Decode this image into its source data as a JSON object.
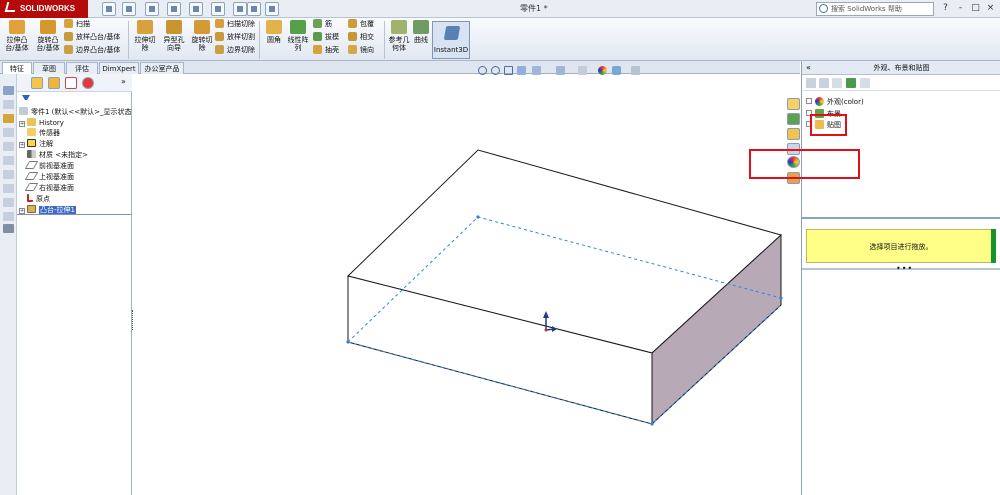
{
  "app": {
    "brand": "SOLIDWORKS",
    "document_title": "零件1 *"
  },
  "search": {
    "placeholder": "搜索 SolidWorks 帮助"
  },
  "window_controls": [
    "?",
    "-",
    "□",
    "×"
  ],
  "ribbon": {
    "big_buttons": [
      {
        "label": "拉伸凸\n台/基体",
        "icon": "extrude-boss-icon"
      },
      {
        "label": "旋转凸\n台/基体",
        "icon": "revolve-boss-icon"
      },
      {
        "label": "拉伸切\n除",
        "icon": "extrude-cut-icon"
      },
      {
        "label": "异型孔\n向导",
        "icon": "hole-wizard-icon"
      },
      {
        "label": "旋转切\n除",
        "icon": "revolve-cut-icon"
      },
      {
        "label": "圆角",
        "icon": "fillet-icon"
      },
      {
        "label": "线性阵\n列",
        "icon": "linear-pattern-icon"
      },
      {
        "label": "参考几\n何体",
        "icon": "reference-geometry-icon"
      },
      {
        "label": "曲线",
        "icon": "curves-icon"
      }
    ],
    "small_group_1": [
      "扫描",
      "放样凸台/基体",
      "边界凸台/基体"
    ],
    "small_group_2": [
      "扫描切除",
      "放样切割",
      "边界切除"
    ],
    "small_group_3": [
      "筋",
      "拔模",
      "抽壳"
    ],
    "small_group_4": [
      "包覆",
      "相交",
      "镜向"
    ],
    "instant3d": "Instant3D"
  },
  "command_tabs": [
    "特征",
    "草图",
    "评估",
    "DimXpert",
    "办公室产品"
  ],
  "feature_tree": {
    "root": "零件1 (默认<<默认>_显示状态",
    "items": [
      "History",
      "传感器",
      "注解",
      "材质 <未指定>",
      "前视基准面",
      "上视基准面",
      "右视基准面",
      "原点",
      "凸台-拉伸1"
    ],
    "selected_index": 8
  },
  "right_panel": {
    "title": "外观、布景和贴图",
    "tree": [
      "外观(color)",
      "布景",
      "贴图"
    ],
    "hint": "选择项目进行拖放。",
    "dots": "•••"
  },
  "colors": {
    "highlight_red": "#e0101a",
    "selection_blue": "#3d6bc4",
    "hint_yellow": "#ffff88",
    "box_side": "#b7a9b6"
  }
}
